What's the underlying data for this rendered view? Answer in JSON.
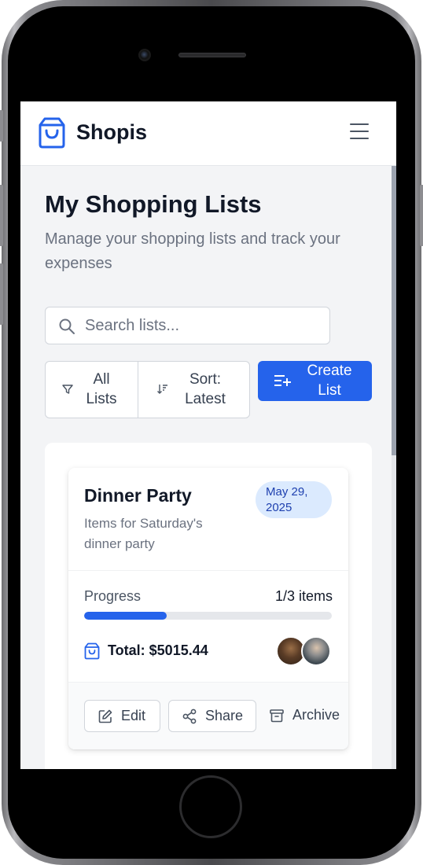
{
  "app": {
    "brand": "Shopis"
  },
  "page": {
    "title": "My Shopping Lists",
    "subtitle": "Manage your shopping lists and track your expenses"
  },
  "search": {
    "placeholder": "Search lists...",
    "value": ""
  },
  "toolbar": {
    "filter_label": "All Lists",
    "sort_label": "Sort: Latest",
    "create_label": "Create List"
  },
  "lists": [
    {
      "title": "Dinner Party",
      "description": "Items for Saturday's dinner party",
      "date": "May 29, 2025",
      "progress_label": "Progress",
      "progress_text": "1/3 items",
      "progress_fraction": 0.333,
      "total": "Total: $5015.44",
      "actions": {
        "edit": "Edit",
        "share": "Share",
        "archive": "Archive"
      }
    }
  ],
  "colors": {
    "accent": "#2563eb",
    "badge_bg": "#dbeafe",
    "badge_text": "#1e40af"
  },
  "icons": [
    "shopping-bag-icon",
    "menu-icon",
    "search-icon",
    "filter-icon",
    "sort-icon",
    "list-plus-icon",
    "edit-icon",
    "share-icon",
    "archive-icon"
  ]
}
